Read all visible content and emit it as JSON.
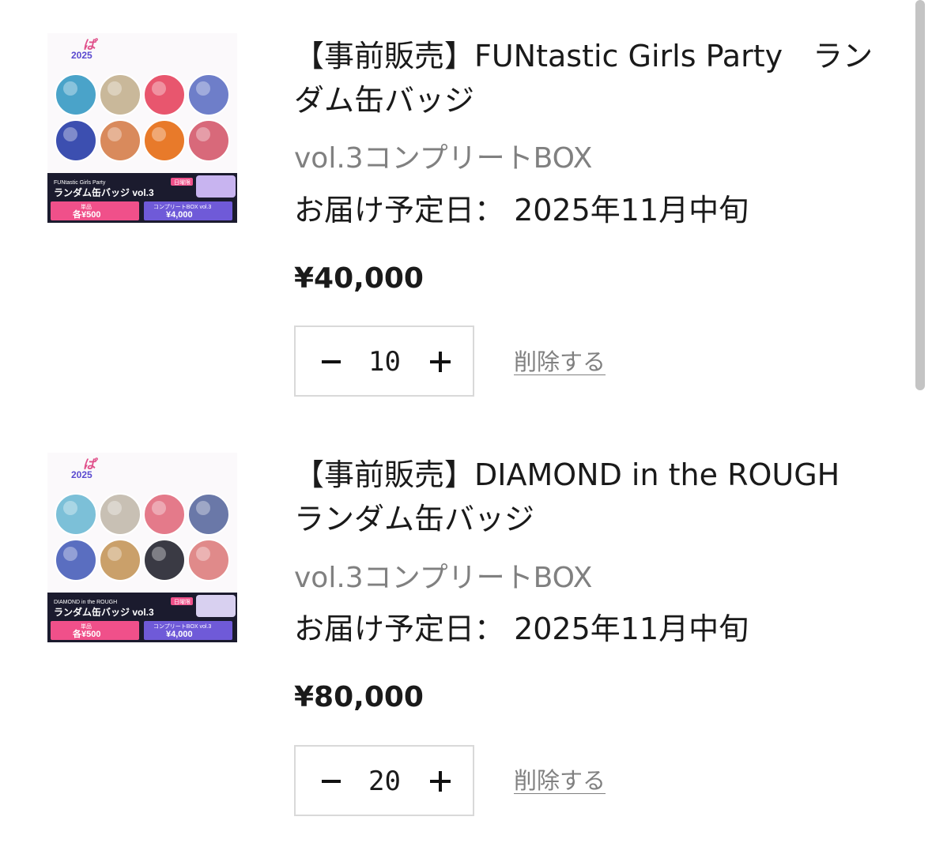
{
  "cart": {
    "items": [
      {
        "title": "【事前販売】FUNtastic Girls Party　ランダム缶バッジ",
        "variant": "vol.3コンプリートBOX",
        "delivery": "お届け予定日：  2025年11月中旬",
        "price": "¥40,000",
        "quantity": "10",
        "remove_label": "削除する",
        "image": {
          "top_logo": "2025",
          "line1": "FUNtastic Girls Party",
          "line2": "ランダム缶バッジ vol.3",
          "tag": "日曜限",
          "single_label": "単品",
          "single_price": "各¥500",
          "box_label": "コンプリートBOX vol.3",
          "box_price": "¥4,000",
          "badge_colors": [
            "#4aa3c9",
            "#c9b89a",
            "#e8566e",
            "#6e7ec9",
            "#3c4fb0",
            "#d98a5c",
            "#e87a2a",
            "#d8697a"
          ]
        }
      },
      {
        "title": "【事前販売】DIAMOND in the ROUGH　ランダム缶バッジ",
        "variant": "vol.3コンプリートBOX",
        "delivery": "お届け予定日：  2025年11月中旬",
        "price": "¥80,000",
        "quantity": "20",
        "remove_label": "削除する",
        "image": {
          "top_logo": "2025",
          "line1": "DIAMOND in the ROUGH",
          "line2": "ランダム缶バッジ vol.3",
          "tag": "日曜限",
          "single_label": "単品",
          "single_price": "各¥500",
          "box_label": "コンプリートBOX vol.3",
          "box_price": "¥4,000",
          "badge_colors": [
            "#7cc0d8",
            "#c8c0b4",
            "#e47a8a",
            "#6a78a8",
            "#5a6ec0",
            "#caa06a",
            "#3a3a44",
            "#e08a8a"
          ]
        }
      }
    ]
  },
  "colors": {
    "text": "#1a1a1a",
    "muted": "#808080",
    "border": "#d9d9d9",
    "pink": "#f0508a",
    "purple": "#6f5ad8",
    "navy": "#1b1b2e"
  }
}
